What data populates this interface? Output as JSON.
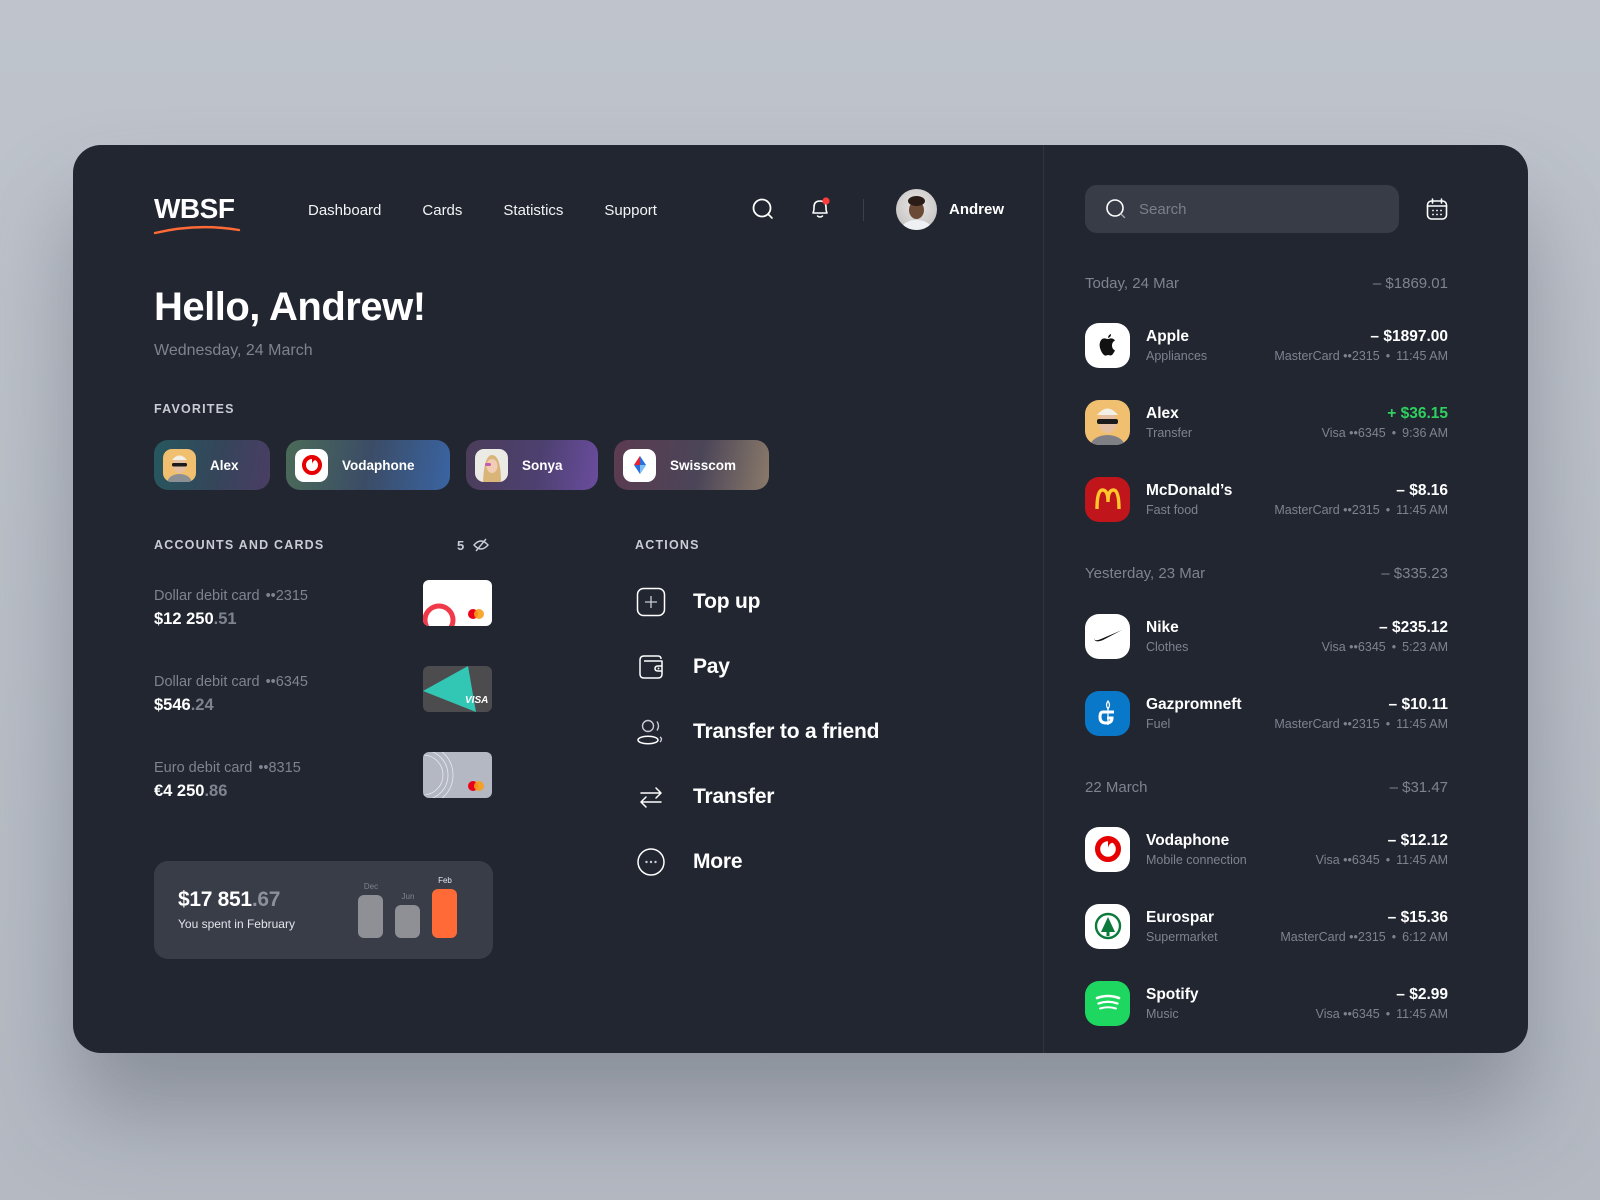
{
  "app": {
    "logo": "WBSF",
    "accent_color": "#ff6a36"
  },
  "nav": {
    "items": [
      "Dashboard",
      "Cards",
      "Statistics",
      "Support"
    ]
  },
  "header": {
    "user_name": "Andrew",
    "notification_dot_color": "#ff3b3b",
    "icons": [
      "search-icon",
      "bell-icon"
    ]
  },
  "greeting": {
    "title": "Hello, Andrew!",
    "date": "Wednesday, 24 March"
  },
  "favorites": {
    "label": "FAVORITES",
    "items": [
      {
        "name": "Alex",
        "icon": "avatar-alex"
      },
      {
        "name": "Vodaphone",
        "icon": "vodafone-logo"
      },
      {
        "name": "Sonya",
        "icon": "avatar-sonya"
      },
      {
        "name": "Swisscom",
        "icon": "swisscom-logo"
      }
    ]
  },
  "accounts": {
    "label": "ACCOUNTS AND CARDS",
    "count": "5",
    "items": [
      {
        "title": "Dollar debit card",
        "mask": "••2315",
        "balance_main": "$12 250",
        "balance_cents": ".51",
        "card_style": "white-mastercard"
      },
      {
        "title": "Dollar debit card",
        "mask": "••6345",
        "balance_main": "$546",
        "balance_cents": ".24",
        "card_style": "teal-visa"
      },
      {
        "title": "Euro debit card",
        "mask": "••8315",
        "balance_main": "€4 250",
        "balance_cents": ".86",
        "card_style": "grey-mastercard"
      }
    ]
  },
  "spending": {
    "amount_main": "$17 851",
    "amount_cents": ".67",
    "caption": "You spent in February",
    "bars": [
      {
        "label": "Dec",
        "relative_value": 0.76,
        "highlight": false
      },
      {
        "label": "Jun",
        "relative_value": 0.59,
        "highlight": true,
        "muted": true
      },
      {
        "label": "Feb",
        "relative_value": 0.88,
        "highlight": true
      }
    ]
  },
  "actions": {
    "label": "ACTIONS",
    "items": [
      {
        "label": "Top up",
        "icon": "plus-square-icon"
      },
      {
        "label": "Pay",
        "icon": "wallet-icon"
      },
      {
        "label": "Transfer to a friend",
        "icon": "users-icon"
      },
      {
        "label": "Transfer",
        "icon": "arrows-swap-icon"
      },
      {
        "label": "More",
        "icon": "more-circle-icon"
      }
    ]
  },
  "search": {
    "placeholder": "Search"
  },
  "transactions": {
    "groups": [
      {
        "date": "Today, 24 Mar",
        "total": "– $1869.01",
        "items": [
          {
            "name": "Apple",
            "category": "Appliances",
            "amount": "– $1897.00",
            "card": "MasterCard ••2315",
            "time": "11:45 AM",
            "positive": false
          },
          {
            "name": "Alex",
            "category": "Transfer",
            "amount": "+ $36.15",
            "card": "Visa ••6345",
            "time": "9:36 AM",
            "positive": true
          },
          {
            "name": "McDonald’s",
            "category": "Fast food",
            "amount": "– $8.16",
            "card": "MasterCard ••2315",
            "time": "11:45 AM",
            "positive": false
          }
        ]
      },
      {
        "date": "Yesterday, 23 Mar",
        "total": "– $335.23",
        "items": [
          {
            "name": "Nike",
            "category": "Clothes",
            "amount": "– $235.12",
            "card": "Visa ••6345",
            "time": "5:23 AM",
            "positive": false
          },
          {
            "name": "Gazpromneft",
            "category": "Fuel",
            "amount": "– $10.11",
            "card": "MasterCard ••2315",
            "time": "11:45 AM",
            "positive": false
          }
        ]
      },
      {
        "date": "22 March",
        "total": "– $31.47",
        "items": [
          {
            "name": "Vodaphone",
            "category": "Mobile connection",
            "amount": "– $12.12",
            "card": "Visa ••6345",
            "time": "11:45 AM",
            "positive": false
          },
          {
            "name": "Eurospar",
            "category": "Supermarket",
            "amount": "– $15.36",
            "card": "MasterCard ••2315",
            "time": "6:12 AM",
            "positive": false
          },
          {
            "name": "Spotify",
            "category": "Music",
            "amount": "– $2.99",
            "card": "Visa ••6345",
            "time": "11:45 AM",
            "positive": false
          }
        ]
      }
    ]
  }
}
